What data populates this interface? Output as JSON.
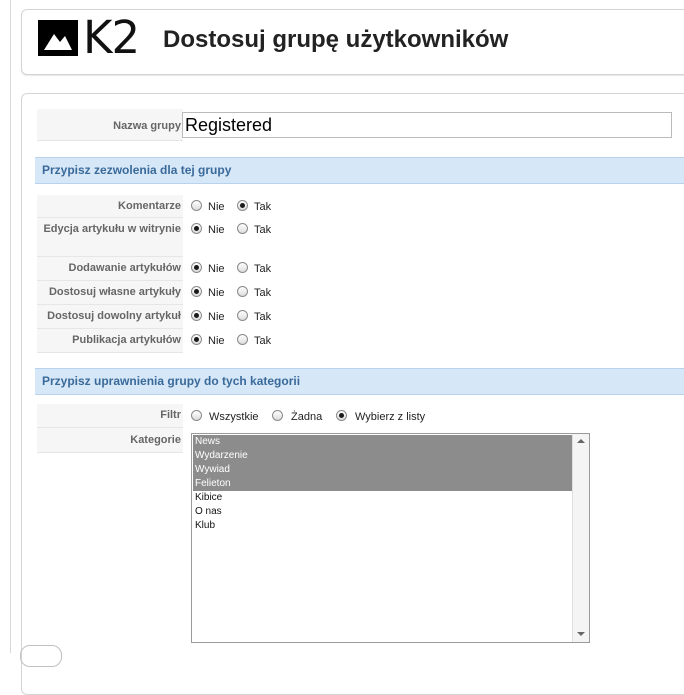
{
  "header": {
    "logo_text": "K2",
    "title": "Dostosuj grupę użytkowników"
  },
  "group_name": {
    "label": "Nazwa grupy",
    "value": "Registered"
  },
  "permissions_section": {
    "title": "Przypisz zezwolenia dla tej grupy",
    "option_no": "Nie",
    "option_yes": "Tak",
    "rows": [
      {
        "label": "Komentarze",
        "selected": "Tak"
      },
      {
        "label": "Edycja artykułu w witrynie",
        "selected": "Nie"
      },
      {
        "label": "Dodawanie artykułów",
        "selected": "Nie"
      },
      {
        "label": "Dostosuj własne artykuły",
        "selected": "Nie"
      },
      {
        "label": "Dostosuj dowolny artykuł",
        "selected": "Nie"
      },
      {
        "label": "Publikacja artykułów",
        "selected": "Nie"
      }
    ]
  },
  "categories_section": {
    "title": "Przypisz uprawnienia grupy do tych kategorii",
    "filter_label": "Filtr",
    "filter_options": [
      "Wszystkie",
      "Żadna",
      "Wybierz z listy"
    ],
    "filter_selected": "Wybierz z listy",
    "categories_label": "Kategorie",
    "categories": [
      {
        "name": "News",
        "selected": true
      },
      {
        "name": "Wydarzenie",
        "selected": true
      },
      {
        "name": "Wywiad",
        "selected": true
      },
      {
        "name": "Felieton",
        "selected": true
      },
      {
        "name": "Kibice",
        "selected": false
      },
      {
        "name": "O nas",
        "selected": false
      },
      {
        "name": "Klub",
        "selected": false
      }
    ]
  },
  "colors": {
    "section_bar": "#d6e7f7",
    "section_text": "#3a6a9a",
    "selected_item": "#8c8c8c"
  }
}
